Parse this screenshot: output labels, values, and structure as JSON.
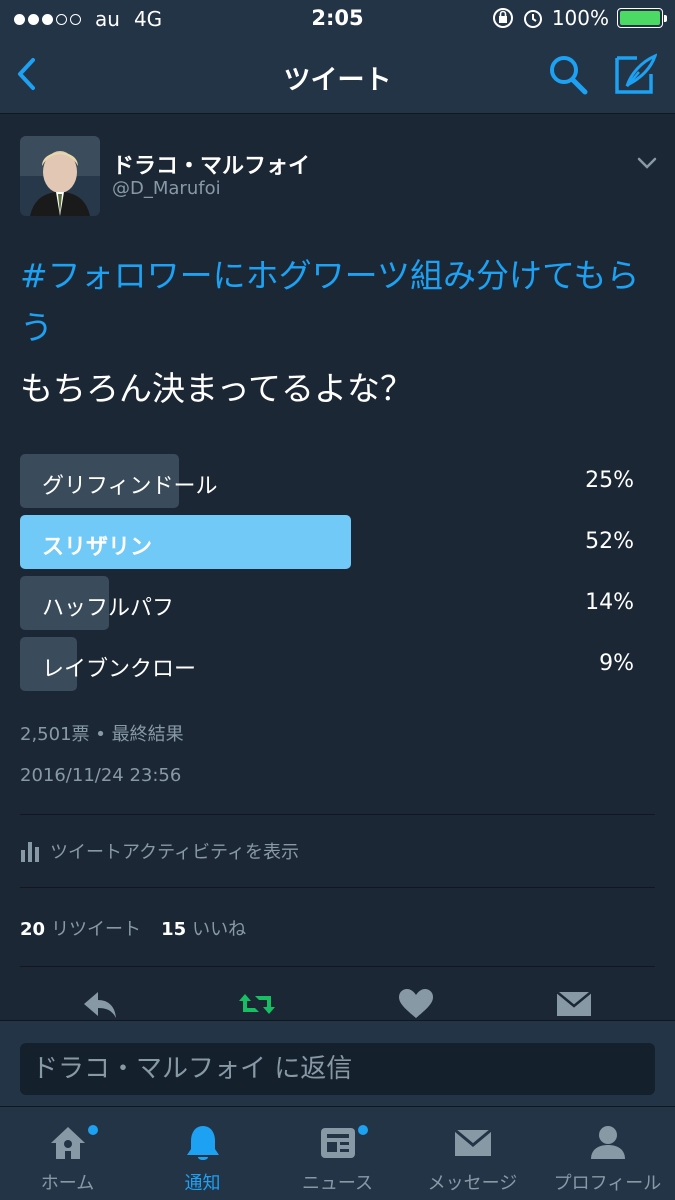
{
  "status_bar": {
    "carrier": "au",
    "network": "4G",
    "time": "2:05",
    "battery": "100%",
    "signal_bars_filled": 3,
    "signal_bars_total": 5
  },
  "nav": {
    "title": "ツイート",
    "back_icon": "chevron-left-icon",
    "search_icon": "search-icon",
    "compose_icon": "compose-icon"
  },
  "tweet": {
    "author_name": "ドラコ・マルフォイ",
    "author_handle": "@D_Marufoi",
    "hashtag": "#フォロワーにホグワーツ組み分けてもらう",
    "text": "もちろん決まってるよな？",
    "poll": {
      "options": [
        {
          "label": "グリフィンドール",
          "percent": "25%",
          "fraction": 0.25,
          "winner": false
        },
        {
          "label": "スリザリン",
          "percent": "52%",
          "fraction": 0.52,
          "winner": true
        },
        {
          "label": "ハッフルパフ",
          "percent": "14%",
          "fraction": 0.14,
          "winner": false
        },
        {
          "label": "レイブンクロー",
          "percent": "9%",
          "fraction": 0.09,
          "winner": false
        }
      ],
      "votes_summary": "2,501票 • 最終結果"
    },
    "timestamp": "2016/11/24 23:56",
    "activity_label": "ツイートアクティビティを表示",
    "retweet_count": "20",
    "retweet_label": "リツイート",
    "like_count": "15",
    "like_label": "いいね"
  },
  "reply": {
    "placeholder": "ドラコ・マルフォイ に返信"
  },
  "tabs": [
    {
      "label": "ホーム",
      "icon": "home-icon",
      "active": false,
      "badge": true
    },
    {
      "label": "通知",
      "icon": "bell-icon",
      "active": true,
      "badge": false
    },
    {
      "label": "ニュース",
      "icon": "news-icon",
      "active": false,
      "badge": true
    },
    {
      "label": "メッセージ",
      "icon": "envelope-icon",
      "active": false,
      "badge": false
    },
    {
      "label": "プロフィール",
      "icon": "person-icon",
      "active": false,
      "badge": false
    }
  ],
  "colors": {
    "background": "#1b2735",
    "bar": "#243447",
    "accent": "#1da1f2",
    "winner_bar": "#71c9f8",
    "poll_bar": "#3a4b5b",
    "retweet_active": "#17bf63",
    "secondary_text": "#8899a6"
  }
}
